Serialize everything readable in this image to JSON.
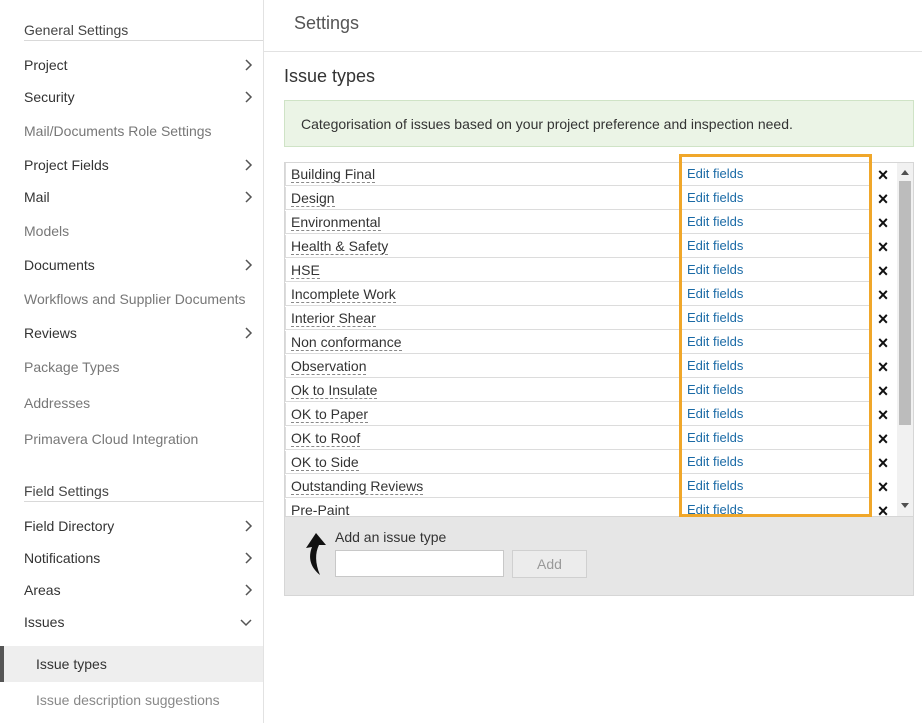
{
  "sidebar": {
    "general_title": "General Settings",
    "field_title": "Field Settings",
    "items": [
      {
        "label": "Project",
        "chevron": "right"
      },
      {
        "label": "Security",
        "chevron": "right"
      },
      {
        "label": "Mail/Documents Role Settings"
      },
      {
        "label": "Project Fields",
        "chevron": "right"
      },
      {
        "label": "Mail",
        "chevron": "right"
      },
      {
        "label": "Models"
      },
      {
        "label": "Documents",
        "chevron": "right"
      },
      {
        "label": "Workflows and Supplier Documents"
      },
      {
        "label": "Reviews",
        "chevron": "right"
      },
      {
        "label": "Package Types"
      },
      {
        "label": "Addresses"
      },
      {
        "label": "Primavera Cloud Integration"
      }
    ],
    "field_items": [
      {
        "label": "Field Directory",
        "chevron": "right"
      },
      {
        "label": "Notifications",
        "chevron": "right"
      },
      {
        "label": "Areas",
        "chevron": "right"
      },
      {
        "label": "Issues",
        "chevron": "down"
      }
    ],
    "selected": "Issue types",
    "sub_item": "Issue description suggestions"
  },
  "header": {
    "title": "Settings"
  },
  "page": {
    "heading": "Issue types",
    "info": "Categorisation of issues based on your project preference and inspection need."
  },
  "issue_types": [
    "Building Final",
    "Design",
    "Environmental",
    "Health & Safety",
    "HSE",
    "Incomplete Work",
    "Interior Shear",
    "Non conformance",
    "Observation",
    "Ok to Insulate",
    "OK to Paper",
    "OK to Roof",
    "OK to Side",
    "Outstanding Reviews",
    "Pre-Paint"
  ],
  "edit_label": "Edit fields",
  "delete_icon": "×",
  "add": {
    "label": "Add an issue type",
    "placeholder": "",
    "button": "Add"
  },
  "colors": {
    "highlight": "#f0a72a",
    "link": "#1a6aa6",
    "info_bg": "#ebf4e6"
  }
}
